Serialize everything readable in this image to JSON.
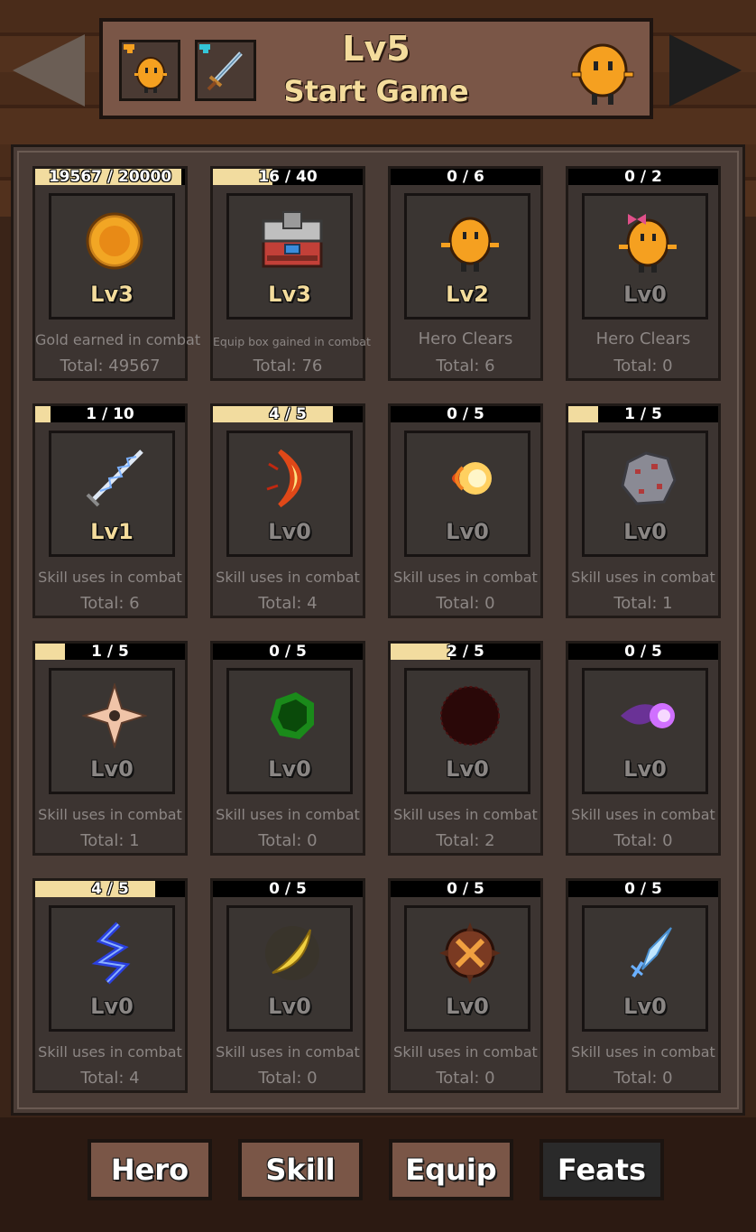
{
  "header": {
    "level": "Lv5",
    "start_label": "Start Game",
    "slots": [
      {
        "icon": "hero-icon"
      },
      {
        "icon": "sword-icon"
      }
    ]
  },
  "nav": {
    "prev": "previous-arrow",
    "next": "next-arrow"
  },
  "cards": [
    {
      "progress": "19567 / 20000",
      "fill": 0.978,
      "icon": "gold-coin-icon",
      "level": "Lv3",
      "active": true,
      "desc": "Gold earned in combat",
      "total": "Total: 49567"
    },
    {
      "progress": "16 / 40",
      "fill": 0.4,
      "icon": "equip-box-icon",
      "level": "Lv3",
      "active": true,
      "desc": "Equip box gained in combat",
      "total": "Total: 76"
    },
    {
      "progress": "0 / 6",
      "fill": 0,
      "icon": "hero-icon",
      "level": "Lv2",
      "active": true,
      "desc": "Hero Clears",
      "total": "Total: 6"
    },
    {
      "progress": "0 / 2",
      "fill": 0,
      "icon": "hero-bow-icon",
      "level": "Lv0",
      "active": false,
      "desc": "Hero Clears",
      "total": "Total: 0"
    },
    {
      "progress": "1 / 10",
      "fill": 0.1,
      "icon": "lightning-sword-icon",
      "level": "Lv1",
      "active": true,
      "desc": "Skill uses in combat",
      "total": "Total: 6"
    },
    {
      "progress": "4 / 5",
      "fill": 0.8,
      "icon": "fire-slash-icon",
      "level": "Lv0",
      "active": false,
      "desc": "Skill uses in combat",
      "total": "Total: 4"
    },
    {
      "progress": "0 / 5",
      "fill": 0,
      "icon": "fireball-icon",
      "level": "Lv0",
      "active": false,
      "desc": "Skill uses in combat",
      "total": "Total: 0"
    },
    {
      "progress": "1 / 5",
      "fill": 0.2,
      "icon": "rock-icon",
      "level": "Lv0",
      "active": false,
      "desc": "Skill uses in combat",
      "total": "Total: 1"
    },
    {
      "progress": "1 / 5",
      "fill": 0.2,
      "icon": "shuriken-icon",
      "level": "Lv0",
      "active": false,
      "desc": "Skill uses in combat",
      "total": "Total: 1"
    },
    {
      "progress": "0 / 5",
      "fill": 0,
      "icon": "poison-icon",
      "level": "Lv0",
      "active": false,
      "desc": "Skill uses in combat",
      "total": "Total: 0"
    },
    {
      "progress": "2 / 5",
      "fill": 0.4,
      "icon": "dark-orb-icon",
      "level": "Lv0",
      "active": false,
      "desc": "Skill uses in combat",
      "total": "Total: 2"
    },
    {
      "progress": "0 / 5",
      "fill": 0,
      "icon": "magic-bolt-icon",
      "level": "Lv0",
      "active": false,
      "desc": "Skill uses in combat",
      "total": "Total: 0"
    },
    {
      "progress": "4 / 5",
      "fill": 0.8,
      "icon": "lightning-icon",
      "level": "Lv0",
      "active": false,
      "desc": "Skill uses in combat",
      "total": "Total: 4"
    },
    {
      "progress": "0 / 5",
      "fill": 0,
      "icon": "golden-crescent-icon",
      "level": "Lv0",
      "active": false,
      "desc": "Skill uses in combat",
      "total": "Total: 0"
    },
    {
      "progress": "0 / 5",
      "fill": 0,
      "icon": "spiked-bomb-icon",
      "level": "Lv0",
      "active": false,
      "desc": "Skill uses in combat",
      "total": "Total: 0"
    },
    {
      "progress": "0 / 5",
      "fill": 0,
      "icon": "ice-blade-icon",
      "level": "Lv0",
      "active": false,
      "desc": "Skill uses in combat",
      "total": "Total: 0"
    }
  ],
  "tabs": [
    {
      "label": "Hero",
      "active": false
    },
    {
      "label": "Skill",
      "active": false
    },
    {
      "label": "Equip",
      "active": false
    },
    {
      "label": "Feats",
      "active": true
    }
  ],
  "colors": {
    "bar_fill": "#f2dc9f",
    "level_active": "#f4dc9c",
    "level_inactive": "#8a8684",
    "hero_orange": "#f5a020"
  }
}
